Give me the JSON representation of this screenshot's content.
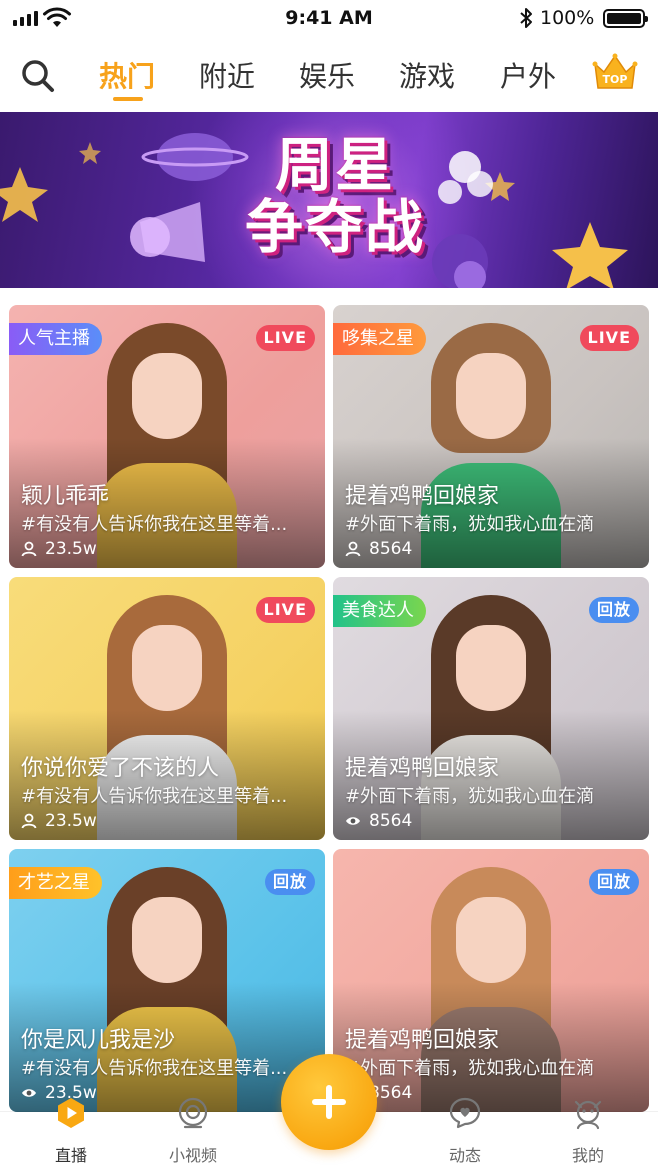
{
  "status_bar": {
    "time": "9:41 AM",
    "battery_pct": "100%",
    "icons": [
      "signal-icon",
      "wifi-icon",
      "bluetooth-icon",
      "battery-icon"
    ]
  },
  "nav": {
    "tabs": [
      {
        "label": "热门",
        "active": true
      },
      {
        "label": "附近",
        "active": false
      },
      {
        "label": "娱乐",
        "active": false
      },
      {
        "label": "游戏",
        "active": false
      },
      {
        "label": "户外",
        "active": false
      }
    ],
    "top_badge": "TOP",
    "icons": [
      "search-icon",
      "crown-top-icon"
    ]
  },
  "banner": {
    "title_line1": "周星",
    "title_line2": "争夺战"
  },
  "cards": [
    {
      "tag": "人气主播",
      "status": "LIVE",
      "title": "颖儿乖乖",
      "desc": "#有没有人告诉你我在这里等着...",
      "stat_icon": "user-icon",
      "stat": "23.5w"
    },
    {
      "tag": "哆集之星",
      "status": "LIVE",
      "title": "提着鸡鸭回娘家",
      "desc": "#外面下着雨，犹如我心血在滴",
      "stat_icon": "user-icon",
      "stat": "8564"
    },
    {
      "tag": "",
      "status": "LIVE",
      "title": "你说你爱了不该的人",
      "desc": "#有没有人告诉你我在这里等着...",
      "stat_icon": "user-icon",
      "stat": "23.5w"
    },
    {
      "tag": "美食达人",
      "status": "回放",
      "title": "提着鸡鸭回娘家",
      "desc": "#外面下着雨，犹如我心血在滴",
      "stat_icon": "eye-icon",
      "stat": "8564"
    },
    {
      "tag": "才艺之星",
      "status": "回放",
      "title": "你是风儿我是沙",
      "desc": "#有没有人告诉你我在这里等着...",
      "stat_icon": "eye-icon",
      "stat": "23.5w"
    },
    {
      "tag": "",
      "status": "回放",
      "title": "提着鸡鸭回娘家",
      "desc": "#外面下着雨，犹如我心血在滴",
      "stat_icon": "eye-icon",
      "stat": "8564"
    }
  ],
  "colors": {
    "accent": "#f7a21b",
    "live": "#f04a5c",
    "replay": "#4a8ef0"
  },
  "tab_bar": {
    "items": [
      {
        "label": "直播",
        "icon": "live-play-icon",
        "active": true
      },
      {
        "label": "小视频",
        "icon": "camera-icon",
        "active": false
      },
      {
        "label": "动态",
        "icon": "chat-bubble-icon",
        "active": false
      },
      {
        "label": "我的",
        "icon": "profile-icon",
        "active": false
      }
    ],
    "fab_icon": "plus-icon"
  }
}
